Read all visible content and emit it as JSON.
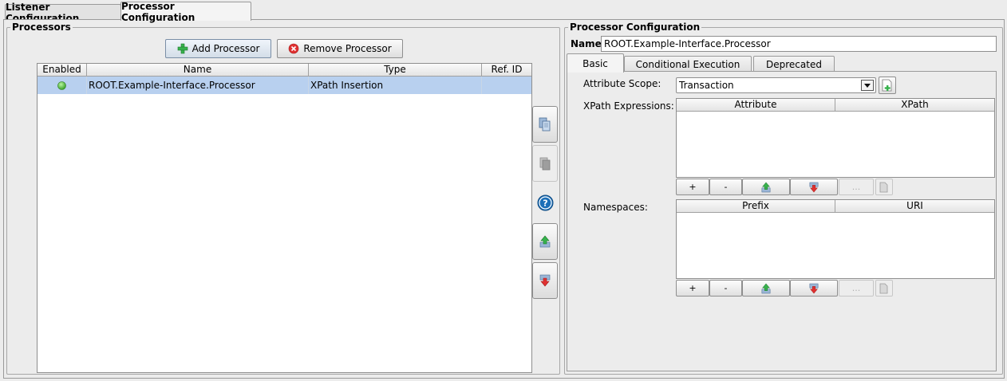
{
  "tabs": [
    "Listener Configuration",
    "Processor Configuration"
  ],
  "left": {
    "title": "Processors",
    "add_label": "Add Processor",
    "remove_label": "Remove Processor",
    "columns": [
      "Enabled",
      "Name",
      "Type",
      "Ref. ID"
    ],
    "rows": [
      {
        "enabled_icon": "green-status-dot",
        "name": "ROOT.Example-Interface.Processor",
        "type": "XPath Insertion",
        "ref_id": ""
      }
    ],
    "side_icons": [
      "copy-icon",
      "paste-icon",
      "help-icon",
      "move-up-icon",
      "move-down-icon"
    ]
  },
  "right": {
    "title": "Processor Configuration",
    "name_label": "Name:",
    "name_value": "ROOT.Example-Interface.Processor",
    "tabs": [
      "Basic",
      "Conditional Execution",
      "Deprecated"
    ],
    "attribute_scope_label": "Attribute Scope:",
    "attribute_scope_value": "Transaction",
    "xpath_label": "XPath Expressions:",
    "xpath_columns": [
      "Attribute",
      "XPath"
    ],
    "namespaces_label": "Namespaces:",
    "namespace_columns": [
      "Prefix",
      "URI"
    ],
    "row_buttons": [
      "+",
      "-",
      "...",
      ""
    ]
  },
  "colors": {
    "selection": "#b8d0ef",
    "accent_green": "#37b24d",
    "accent_red": "#e03131",
    "help_blue": "#1c6fb8"
  }
}
